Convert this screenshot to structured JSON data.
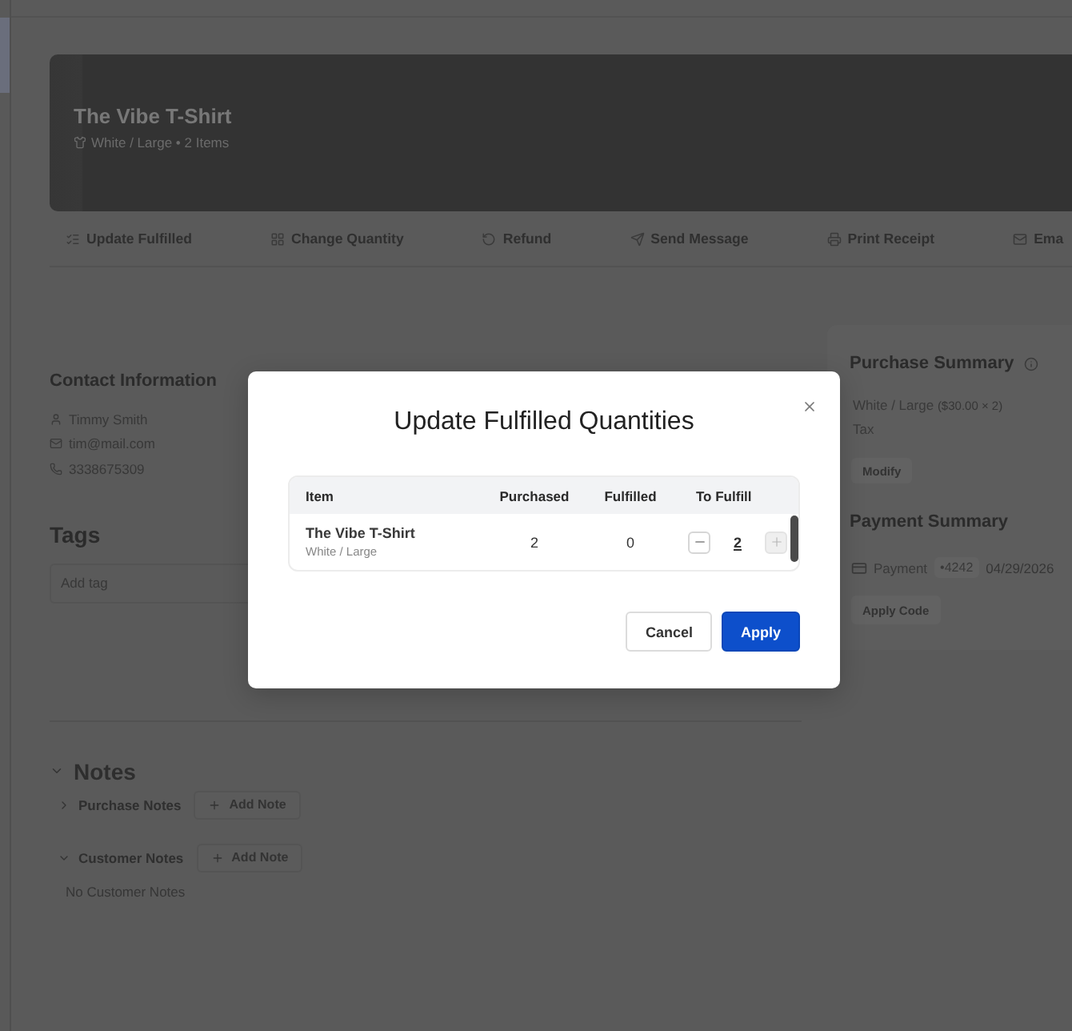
{
  "sidebar": {
    "items": [
      {
        "selected": true
      }
    ]
  },
  "product": {
    "title": "The Vibe T-Shirt",
    "subtitle": "White / Large • 2 Items"
  },
  "actions": [
    {
      "label": "Update Fulfilled"
    },
    {
      "label": "Change Quantity"
    },
    {
      "label": "Refund"
    },
    {
      "label": "Send Message"
    },
    {
      "label": "Print Receipt"
    },
    {
      "label": "Ema"
    }
  ],
  "contact": {
    "title": "Contact Information",
    "name": "Timmy Smith",
    "email": "tim@mail.com",
    "phone": "3338675309"
  },
  "tags": {
    "title": "Tags",
    "placeholder": "Add tag"
  },
  "notes": {
    "title": "Notes",
    "expanded": true,
    "sections": [
      {
        "title": "Purchase Notes",
        "expanded": false,
        "button": "Add Note"
      },
      {
        "title": "Customer Notes",
        "expanded": true,
        "button": "Add Note",
        "empty": "No Customer Notes"
      }
    ]
  },
  "purchase_summary": {
    "title": "Purchase Summary",
    "item": "White / Large",
    "item_detail": "($30.00 × 2)",
    "tax": "Tax",
    "button": "Modify"
  },
  "payment_summary": {
    "title": "Payment Summary",
    "label": "Payment",
    "card": "•4242",
    "date": "04/29/2026",
    "button": "Apply Code"
  },
  "modal": {
    "title": "Update Fulfilled Quantities",
    "columns": [
      "Item",
      "Purchased",
      "Fulfilled",
      "To Fulfill"
    ],
    "rows": [
      {
        "item": "The Vibe T-Shirt",
        "variant": "White / Large",
        "purchased": "2",
        "fulfilled": "0",
        "to_fulfill": "2",
        "decrease_disabled": false,
        "increase_disabled": true
      }
    ],
    "buttons": [
      {
        "label": "Cancel",
        "kind": "secondary"
      },
      {
        "label": "Apply",
        "kind": "primary"
      }
    ]
  }
}
